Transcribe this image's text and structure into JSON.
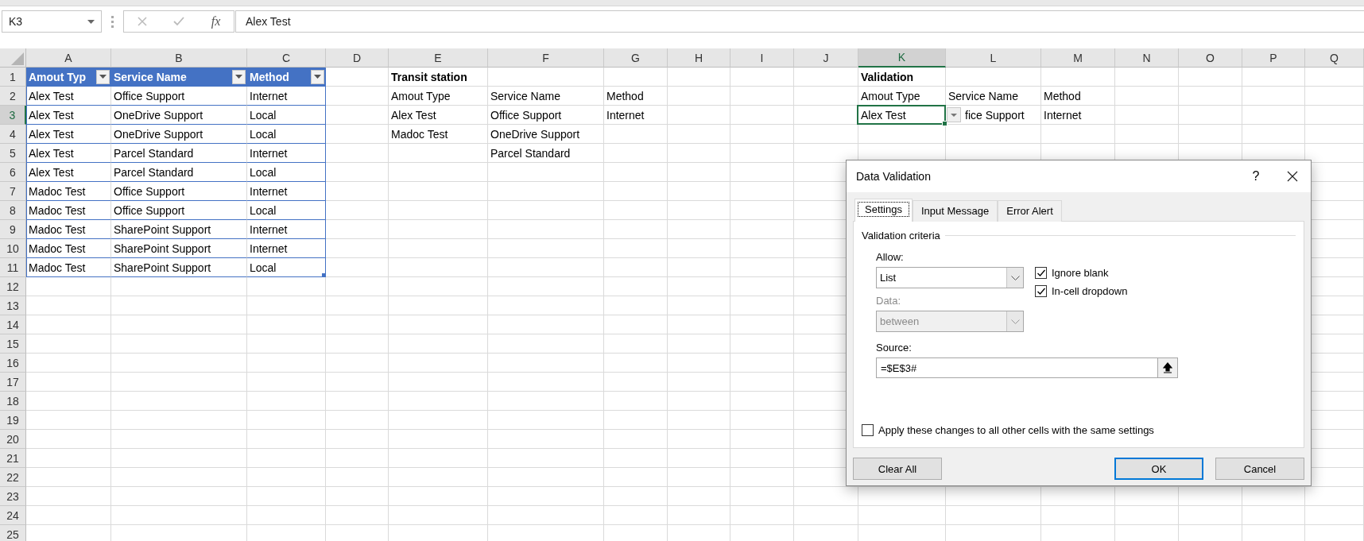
{
  "formula_bar": {
    "name_box": "K3",
    "function_label": "fx",
    "formula": "Alex Test"
  },
  "columns": [
    {
      "letter": "A"
    },
    {
      "letter": "B"
    },
    {
      "letter": "C"
    },
    {
      "letter": "D"
    },
    {
      "letter": "E"
    },
    {
      "letter": "F"
    },
    {
      "letter": "G"
    },
    {
      "letter": "H"
    },
    {
      "letter": "I"
    },
    {
      "letter": "J"
    },
    {
      "letter": "K"
    },
    {
      "letter": "L"
    },
    {
      "letter": "M"
    },
    {
      "letter": "N"
    },
    {
      "letter": "O"
    },
    {
      "letter": "P"
    },
    {
      "letter": "Q"
    }
  ],
  "rows": [
    {
      "number": "1",
      "cells": {
        "A": {
          "text": "Amout Typ",
          "kind": "table_header"
        },
        "B": {
          "text": "Service Name",
          "kind": "table_header"
        },
        "C": {
          "text": "Method",
          "kind": "table_header"
        },
        "E": {
          "text": "Transit station",
          "kind": "bold"
        },
        "K": {
          "text": "Validation",
          "kind": "bold"
        }
      }
    },
    {
      "number": "2",
      "cells": {
        "A": {
          "text": "Alex Test",
          "kind": "table_body"
        },
        "B": {
          "text": "Office Support",
          "kind": "table_body"
        },
        "C": {
          "text": "Internet",
          "kind": "table_body"
        },
        "E": {
          "text": "Amout Type",
          "kind": "plain"
        },
        "F": {
          "text": "Service Name",
          "kind": "plain"
        },
        "G": {
          "text": "Method",
          "kind": "plain"
        },
        "K": {
          "text": "Amout Type",
          "kind": "plain"
        },
        "L": {
          "text": "Service Name",
          "kind": "plain"
        },
        "M": {
          "text": "Method",
          "kind": "plain"
        }
      }
    },
    {
      "number": "3",
      "cells": {
        "A": {
          "text": "Alex Test",
          "kind": "table_body"
        },
        "B": {
          "text": "OneDrive Support",
          "kind": "table_body"
        },
        "C": {
          "text": "Local",
          "kind": "table_body"
        },
        "E": {
          "text": "Alex Test",
          "kind": "plain"
        },
        "F": {
          "text": "Office Support",
          "kind": "plain"
        },
        "G": {
          "text": "Internet",
          "kind": "plain"
        },
        "K": {
          "text": "Alex Test",
          "kind": "plain",
          "selected": true,
          "dropdown": true
        },
        "L": {
          "text": "fice Support",
          "kind": "plain"
        },
        "M": {
          "text": "Internet",
          "kind": "plain"
        }
      }
    },
    {
      "number": "4",
      "cells": {
        "A": {
          "text": "Alex Test",
          "kind": "table_body"
        },
        "B": {
          "text": "OneDrive Support",
          "kind": "table_body"
        },
        "C": {
          "text": "Local",
          "kind": "table_body"
        },
        "E": {
          "text": "Madoc Test",
          "kind": "plain"
        },
        "F": {
          "text": "OneDrive Support",
          "kind": "plain"
        }
      }
    },
    {
      "number": "5",
      "cells": {
        "A": {
          "text": "Alex Test",
          "kind": "table_body"
        },
        "B": {
          "text": "Parcel Standard",
          "kind": "table_body"
        },
        "C": {
          "text": "Internet",
          "kind": "table_body"
        },
        "F": {
          "text": "Parcel Standard",
          "kind": "plain"
        }
      }
    },
    {
      "number": "6",
      "cells": {
        "A": {
          "text": "Alex Test",
          "kind": "table_body"
        },
        "B": {
          "text": "Parcel Standard",
          "kind": "table_body"
        },
        "C": {
          "text": "Local",
          "kind": "table_body"
        }
      }
    },
    {
      "number": "7",
      "cells": {
        "A": {
          "text": "Madoc Test",
          "kind": "table_body"
        },
        "B": {
          "text": "Office Support",
          "kind": "table_body"
        },
        "C": {
          "text": "Internet",
          "kind": "table_body"
        }
      }
    },
    {
      "number": "8",
      "cells": {
        "A": {
          "text": "Madoc Test",
          "kind": "table_body"
        },
        "B": {
          "text": "Office Support",
          "kind": "table_body"
        },
        "C": {
          "text": "Local",
          "kind": "table_body"
        }
      }
    },
    {
      "number": "9",
      "cells": {
        "A": {
          "text": "Madoc Test",
          "kind": "table_body"
        },
        "B": {
          "text": "SharePoint Support",
          "kind": "table_body"
        },
        "C": {
          "text": "Internet",
          "kind": "table_body"
        }
      }
    },
    {
      "number": "10",
      "cells": {
        "A": {
          "text": "Madoc Test",
          "kind": "table_body"
        },
        "B": {
          "text": "SharePoint Support",
          "kind": "table_body"
        },
        "C": {
          "text": "Internet",
          "kind": "table_body"
        }
      }
    },
    {
      "number": "11",
      "cells": {
        "A": {
          "text": "Madoc Test",
          "kind": "table_body"
        },
        "B": {
          "text": "SharePoint Support",
          "kind": "table_body"
        },
        "C": {
          "text": "Local",
          "kind": "table_body"
        }
      }
    },
    {
      "number": "12"
    },
    {
      "number": "13"
    },
    {
      "number": "14"
    },
    {
      "number": "15"
    },
    {
      "number": "16"
    },
    {
      "number": "17"
    },
    {
      "number": "18"
    },
    {
      "number": "19"
    },
    {
      "number": "20"
    },
    {
      "number": "21"
    },
    {
      "number": "22"
    },
    {
      "number": "23"
    },
    {
      "number": "24"
    },
    {
      "number": "25"
    }
  ],
  "dialog": {
    "title": "Data Validation",
    "help": "?",
    "tabs": [
      {
        "label": "Settings",
        "selected": true
      },
      {
        "label": "Input Message",
        "selected": false
      },
      {
        "label": "Error Alert",
        "selected": false
      }
    ],
    "group_label": "Validation criteria",
    "allow": {
      "label": "Allow:",
      "value": "List",
      "disabled": false
    },
    "data": {
      "label": "Data:",
      "value": "between",
      "disabled": true
    },
    "checkboxes": [
      {
        "label": "Ignore blank",
        "checked": true
      },
      {
        "label": "In-cell dropdown",
        "checked": true
      }
    ],
    "source": {
      "label": "Source:",
      "value": "=$E$3#"
    },
    "apply_all": {
      "label": "Apply these changes to all other cells with the same settings",
      "checked": false
    },
    "buttons": [
      {
        "label": "Clear All",
        "default": false
      },
      {
        "label": "OK",
        "default": true
      },
      {
        "label": "Cancel",
        "default": false
      }
    ]
  }
}
